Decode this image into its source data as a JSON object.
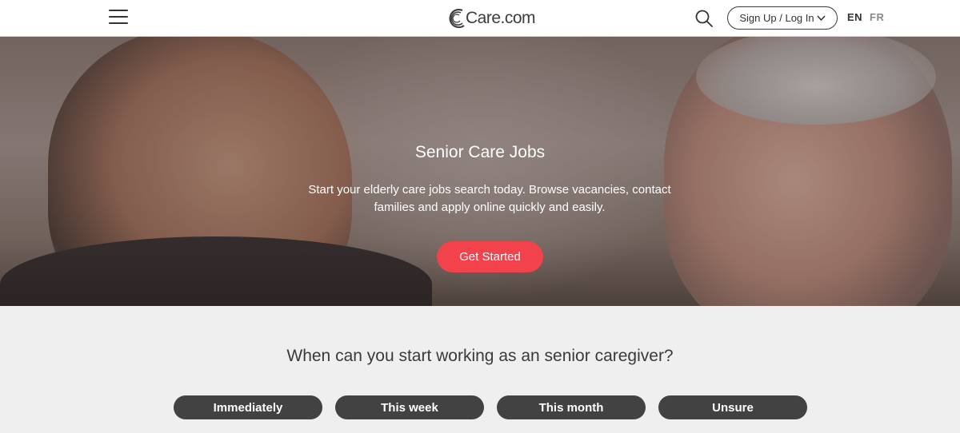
{
  "header": {
    "menu_icon": "hamburger-menu-icon",
    "logo_text": "Care.com",
    "search_icon": "search-icon",
    "signup_label": "Sign Up / Log In",
    "signup_icon": "chevron-down-icon",
    "languages": {
      "en": "EN",
      "fr": "FR"
    }
  },
  "hero": {
    "title": "Senior Care Jobs",
    "subtitle": "Start your elderly care jobs search today. Browse vacancies, contact families and apply online quickly and easily.",
    "cta_label": "Get Started",
    "cta_color": "#f2434c"
  },
  "question": {
    "text": "When can you start working as an senior caregiver?",
    "options": [
      {
        "label": "Immediately"
      },
      {
        "label": "This week"
      },
      {
        "label": "This month"
      },
      {
        "label": "Unsure"
      }
    ]
  }
}
